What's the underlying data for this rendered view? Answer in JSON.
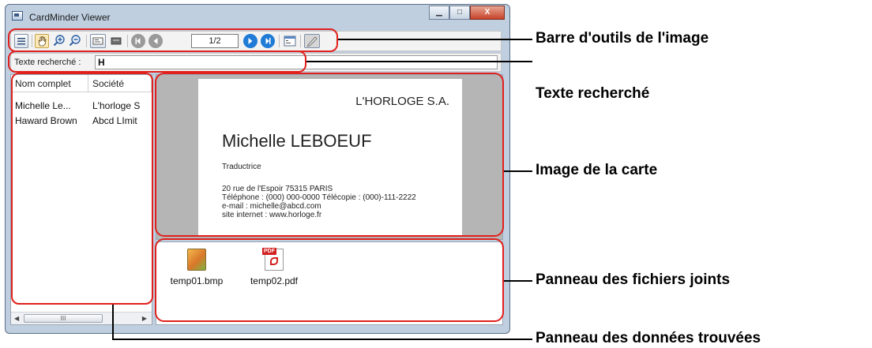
{
  "window": {
    "title": "CardMinder Viewer",
    "controls": {
      "minimize": "▁",
      "maximize": "□",
      "close": "X"
    }
  },
  "toolbar": {
    "page_indicator": "1/2",
    "icons": [
      "list-view-icon",
      "hand-icon",
      "zoom-in-icon",
      "zoom-out-icon",
      "card-view-icon",
      "compact-view-icon",
      "first-page-icon",
      "prev-page-icon",
      "next-page-icon",
      "last-page-icon",
      "properties-icon",
      "edit-icon"
    ]
  },
  "search": {
    "label": "Texte recherché :",
    "value": "H"
  },
  "results": {
    "columns": [
      "Nom complet",
      "Société"
    ],
    "rows": [
      [
        "Michelle Le...",
        "L'horloge S"
      ],
      [
        "Haward Brown",
        "Abcd LImit"
      ]
    ],
    "scroll_thumb": "III"
  },
  "card": {
    "company": "L'HORLOGE S.A.",
    "name": "Michelle LEBOEUF",
    "role": "Traductrice",
    "address": "20 rue de l'Espoir 75315 PARIS",
    "phone_fax": "Téléphone : (000) 000-0000   Télécopie : (000)-111-2222",
    "email": "e-mail : michelle@abcd.com",
    "website": "site internet : www.horloge.fr"
  },
  "attachments": [
    {
      "name": "temp01.bmp",
      "icon": "bmp-file-icon"
    },
    {
      "name": "temp02.pdf",
      "icon": "pdf-file-icon",
      "badge": "PDF"
    }
  ],
  "callouts": {
    "toolbar": "Barre d'outils de l'image",
    "search": "Texte recherché",
    "card_image": "Image de la carte",
    "attachments": "Panneau des fichiers joints",
    "found_data": "Panneau des données trouvées"
  },
  "colors": {
    "highlight": "#e0201c",
    "window_frame": "#bfcfe0",
    "image_background": "#b5b5b5"
  }
}
